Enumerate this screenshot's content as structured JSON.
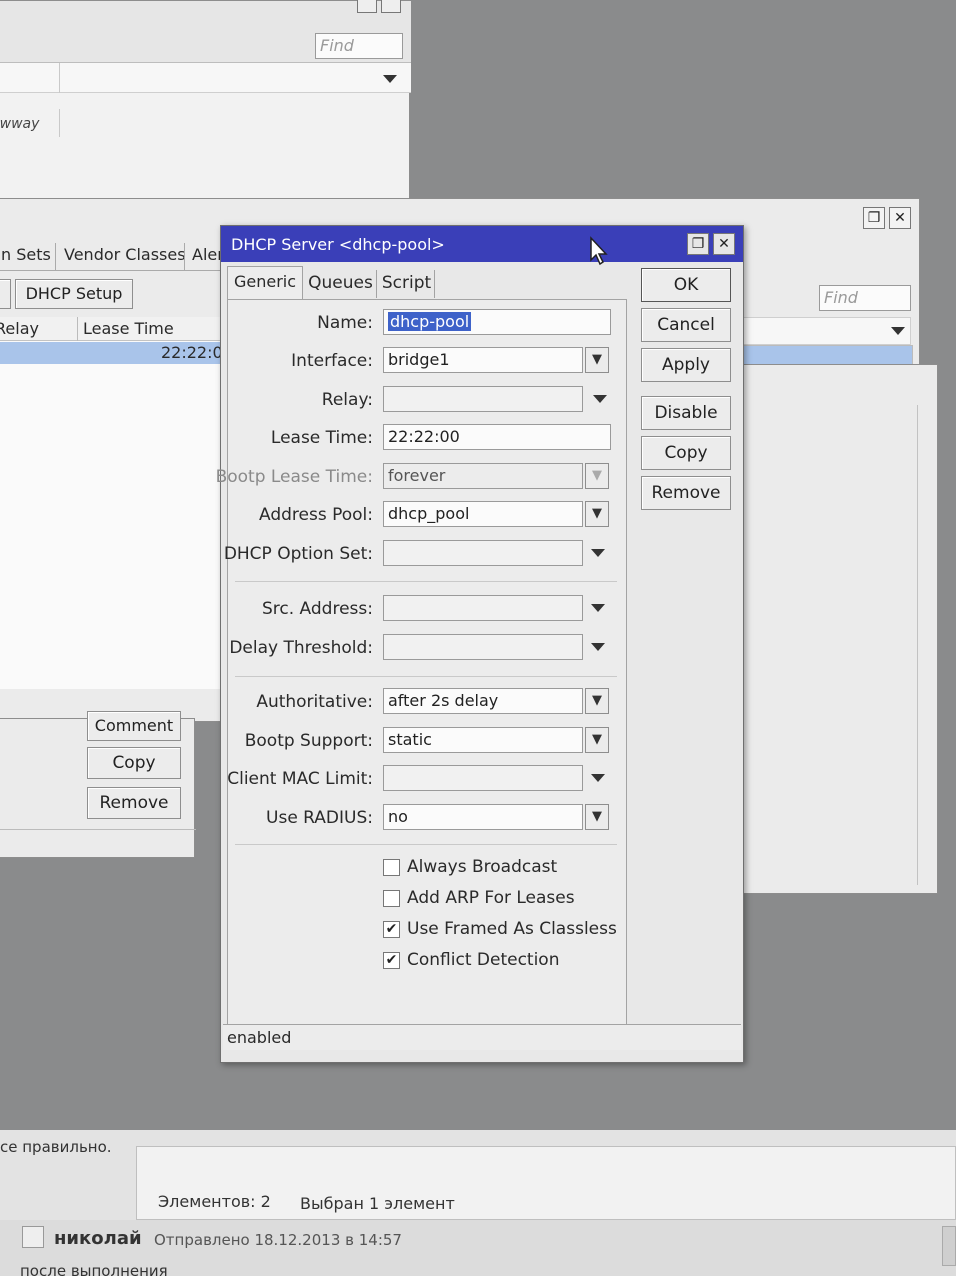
{
  "background_window_top": {
    "find_placeholder": "Find",
    "row_partial_label": "ewway"
  },
  "background_window_dhcp": {
    "tabs": [
      "n Sets",
      "Vendor Classes",
      "Alert"
    ],
    "dhcp_setup_label": "DHCP Setup",
    "col_relay": "Relay",
    "col_lease_time": "Lease Time",
    "row_lease_time": "22:22:00",
    "find_placeholder": "Find"
  },
  "background_window_lower": {
    "comment_label": "Comment",
    "copy_label": "Copy",
    "remove_label": "Remove"
  },
  "dialog": {
    "title": "DHCP Server <dhcp-pool>",
    "tabs": {
      "generic": "Generic",
      "queues": "Queues",
      "script": "Script"
    },
    "fields": {
      "name": {
        "label": "Name:",
        "value": "dhcp-pool"
      },
      "interface": {
        "label": "Interface:",
        "value": "bridge1"
      },
      "relay": {
        "label": "Relay:",
        "value": ""
      },
      "lease_time": {
        "label": "Lease Time:",
        "value": "22:22:00"
      },
      "bootp_lease_time": {
        "label": "Bootp Lease Time:",
        "value": "forever"
      },
      "address_pool": {
        "label": "Address Pool:",
        "value": "dhcp_pool"
      },
      "dhcp_option_set": {
        "label": "DHCP Option Set:",
        "value": ""
      },
      "src_address": {
        "label": "Src. Address:",
        "value": ""
      },
      "delay_threshold": {
        "label": "Delay Threshold:",
        "value": ""
      },
      "authoritative": {
        "label": "Authoritative:",
        "value": "after 2s delay"
      },
      "bootp_support": {
        "label": "Bootp Support:",
        "value": "static"
      },
      "client_mac_limit": {
        "label": "Client MAC Limit:",
        "value": ""
      },
      "use_radius": {
        "label": "Use RADIUS:",
        "value": "no"
      }
    },
    "checkboxes": {
      "always_broadcast": {
        "label": "Always Broadcast",
        "checked": false
      },
      "add_arp": {
        "label": "Add ARP For Leases",
        "checked": false
      },
      "use_framed": {
        "label": "Use Framed As Classless",
        "checked": true
      },
      "conflict_detection": {
        "label": "Conflict Detection",
        "checked": true
      }
    },
    "buttons": {
      "ok": "OK",
      "cancel": "Cancel",
      "apply": "Apply",
      "disable": "Disable",
      "copy": "Copy",
      "remove": "Remove"
    },
    "status": "enabled",
    "check_mark": "✔"
  },
  "forum": {
    "partial_text": "се правильно.",
    "items_count": "Элементов: 2",
    "selected": "Выбран 1 элемент",
    "author": "николай",
    "posted": "Отправлено 18.12.2013 в 14:57",
    "next_line_partial": "после выполнения"
  },
  "colors": {
    "title_bar": "#3a3fb8",
    "selection": "#3e62c9",
    "row_highlight": "#a9c4ea"
  }
}
